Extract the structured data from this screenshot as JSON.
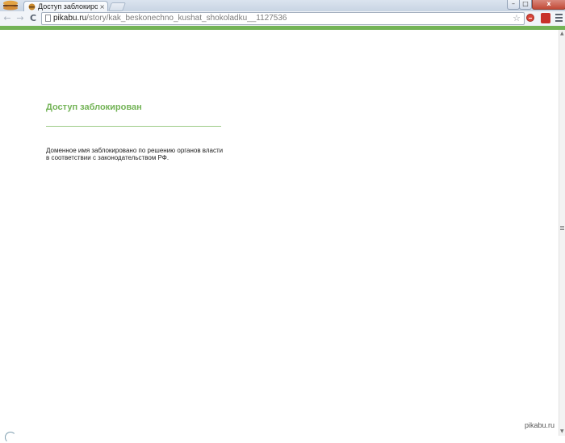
{
  "browser": {
    "tab": {
      "title": "Доступ заблокирован",
      "close_glyph": "×"
    },
    "window_buttons": {
      "minimize": "–",
      "maximize": "□",
      "close": "x"
    },
    "nav": {
      "back": "←",
      "forward": "→",
      "reload": "C"
    },
    "address": {
      "host": "pikabu.ru",
      "path": "/story/kak_beskonechno_kushat_shokoladku__1127536"
    },
    "bookmark_glyph": "☆",
    "icons": [
      "app-icon",
      "tab-favicon",
      "back-arrow-icon",
      "forward-arrow-icon",
      "reload-icon",
      "page-icon",
      "star-icon",
      "adblock-icon",
      "extension-icon",
      "menu-icon"
    ],
    "accent_color": "#73b356"
  },
  "page": {
    "heading": "Доступ заблокирован",
    "body_line1": "Доменное имя заблокировано по решению органов власти",
    "body_line2": "в соответствии с законодательством РФ."
  },
  "watermark": "pikabu.ru"
}
